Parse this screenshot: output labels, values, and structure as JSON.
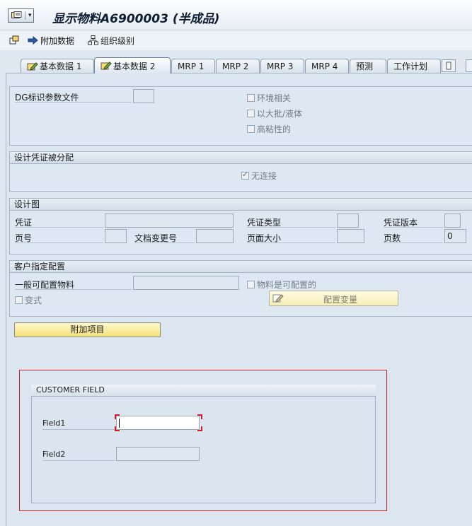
{
  "title": "显示物料A6900003 (半成品)",
  "toolbar": {
    "additional_data": "附加数据",
    "org_levels": "组织级别"
  },
  "tabs": [
    {
      "label": "基本数据 1"
    },
    {
      "label": "基本数据 2"
    },
    {
      "label": "MRP 1"
    },
    {
      "label": "MRP 2"
    },
    {
      "label": "MRP 3"
    },
    {
      "label": "MRP 4"
    },
    {
      "label": "预测"
    },
    {
      "label": "工作计划"
    }
  ],
  "other_data": {
    "dg_profile_label": "DG标识参数文件",
    "env_relevant": "环境相关",
    "bulk_liquid": "以大批/液体",
    "high_viscosity": "高粘性的"
  },
  "doc_assign": {
    "header": "设计凭证被分配",
    "no_link": "无连接"
  },
  "design_drawing": {
    "header": "设计图",
    "doc_label": "凭证",
    "doc_type_label": "凭证类型",
    "doc_version_label": "凭证版本",
    "page_no_label": "页号",
    "doc_change_no_label": "文档变更号",
    "page_format_label": "页面大小",
    "page_count_label": "页数",
    "page_count_value": "0"
  },
  "config": {
    "header": "客户指定配置",
    "general_config_label": "一般可配置物料",
    "configurable": "物料是可配置的",
    "variant": "变式",
    "config_variant_button": "配置变量"
  },
  "additional_items_button": "附加项目",
  "customer_field": {
    "header": "CUSTOMER FIELD",
    "field1_label": "Field1",
    "field2_label": "Field2"
  }
}
